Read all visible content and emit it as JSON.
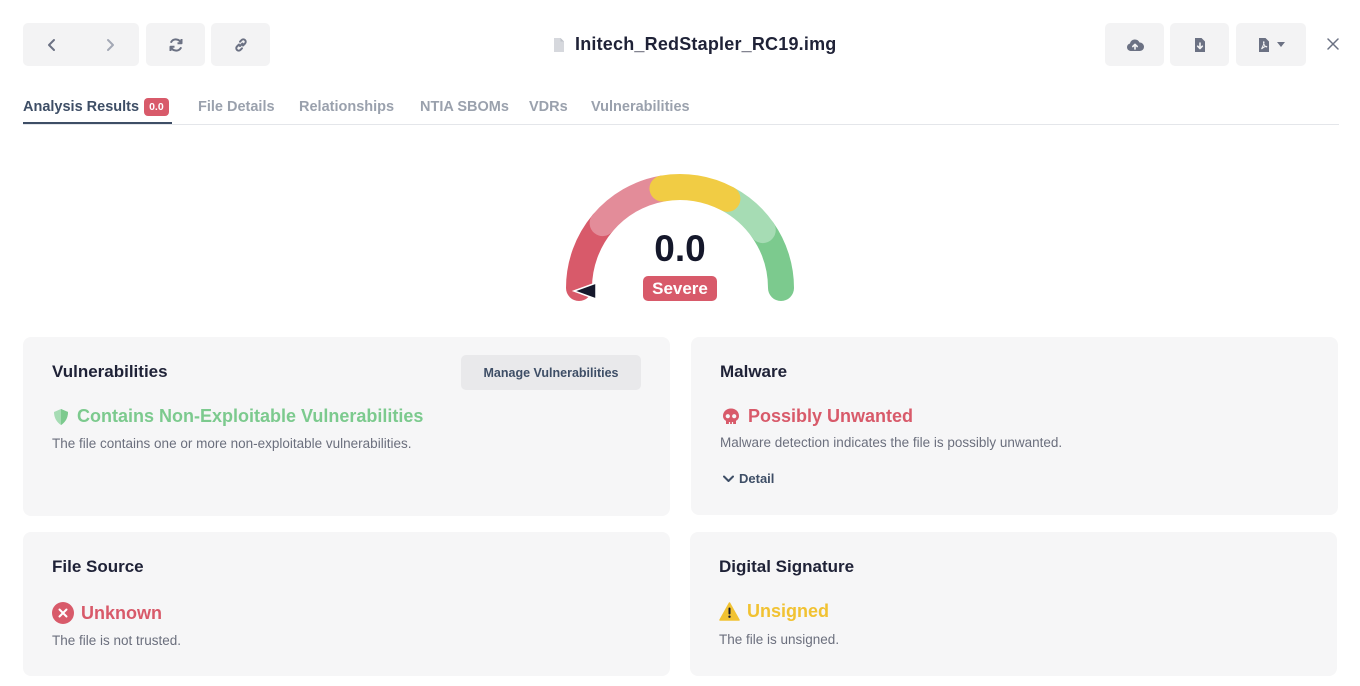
{
  "header": {
    "file_name": "Initech_RedStapler_RC19.img",
    "icons": {
      "back": "chevron-left-icon",
      "forward": "chevron-right-icon",
      "refresh": "refresh-icon",
      "link": "link-icon",
      "cloud": "cloud-upload-icon",
      "download": "file-download-icon",
      "pdf": "pdf-file-icon",
      "close": "close-icon"
    }
  },
  "tabs": [
    {
      "label": "Analysis Results",
      "badge": "0.0",
      "active": true
    },
    {
      "label": "File Details"
    },
    {
      "label": "Relationships"
    },
    {
      "label": "NTIA SBOMs"
    },
    {
      "label": "VDRs"
    },
    {
      "label": "Vulnerabilities"
    }
  ],
  "gauge": {
    "score": "0.0",
    "severity": "Severe",
    "score_value": 0.0,
    "segment_colors": [
      "#d85a6a",
      "#e38c99",
      "#f1cc44",
      "#a6dcb4",
      "#7cca8e"
    ]
  },
  "cards": {
    "vulnerabilities": {
      "title": "Vulnerabilities",
      "button": "Manage Vulnerabilities",
      "status": "Contains Non-Exploitable Vulnerabilities",
      "status_color": "#7cca8e",
      "description": "The file contains one or more non-exploitable vulnerabilities."
    },
    "malware": {
      "title": "Malware",
      "status": "Possibly Unwanted",
      "status_color": "#d85a6a",
      "description": "Malware detection indicates the file is possibly unwanted.",
      "detail": "Detail"
    },
    "file_source": {
      "title": "File Source",
      "status": "Unknown",
      "status_color": "#d85a6a",
      "description": "The file is not trusted."
    },
    "digital_signature": {
      "title": "Digital Signature",
      "status": "Unsigned",
      "status_color": "#f1c232",
      "description": "The file is unsigned."
    }
  }
}
